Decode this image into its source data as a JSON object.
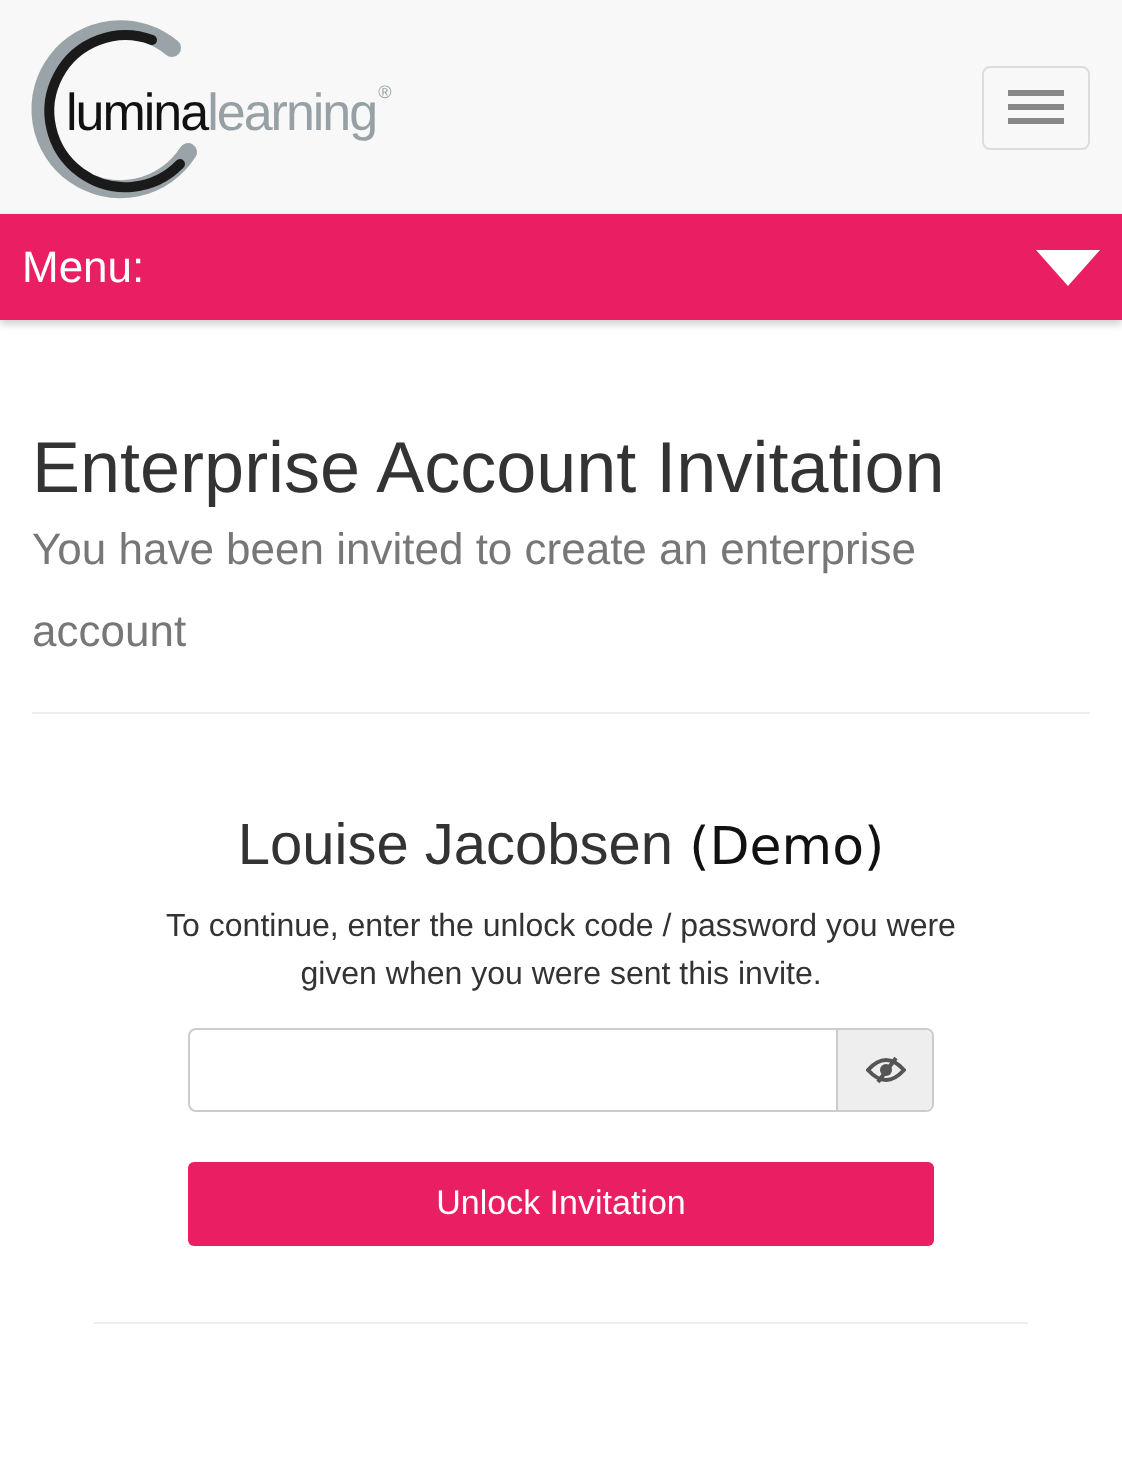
{
  "logo": {
    "primary": "lumina",
    "secondary": "learning",
    "mark": "®"
  },
  "menu_bar": {
    "label": "Menu:"
  },
  "page": {
    "title": "Enterprise Account Invitation",
    "subtitle": "You have been invited to create an enterprise account"
  },
  "invitation": {
    "name": "Louise Jacobsen",
    "tag": "(Demo)",
    "instructions": "To continue, enter the unlock code / password you were given when you were sent this invite.",
    "password_visible": false,
    "button": "Unlock Invitation"
  }
}
